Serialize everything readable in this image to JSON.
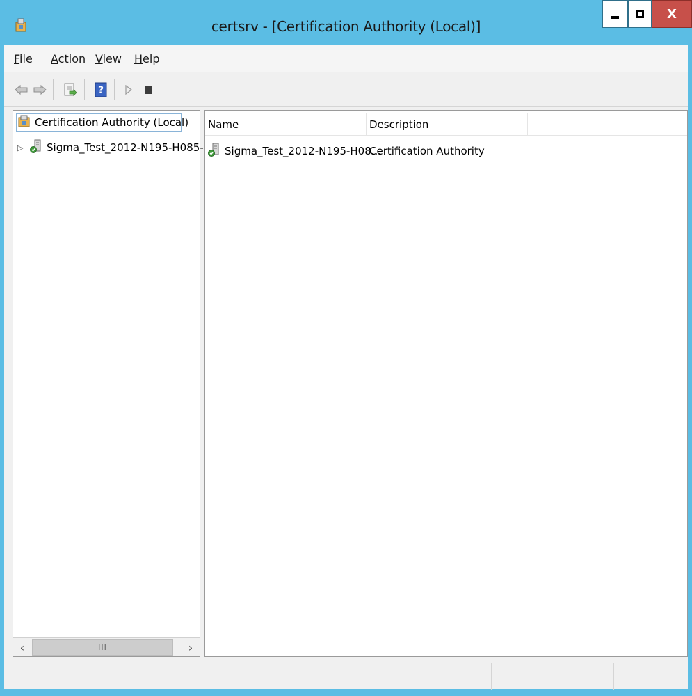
{
  "window": {
    "title": "certsrv - [Certification Authority (Local)]",
    "close_label": "X"
  },
  "menu": {
    "items": [
      {
        "label": "File"
      },
      {
        "label": "Action"
      },
      {
        "label": "View"
      },
      {
        "label": "Help"
      }
    ]
  },
  "toolbar": {
    "buttons": [
      "back-arrow-icon",
      "forward-arrow-icon",
      "export-list-icon",
      "help-icon",
      "start-service-icon",
      "stop-service-icon"
    ]
  },
  "tree": {
    "root_label": "Certification Authority (Local)",
    "child_label": "Sigma_Test_2012-N195-H085-",
    "scroll_thumb_grip": "III"
  },
  "list": {
    "columns": [
      "Name",
      "Description",
      ""
    ],
    "rows": [
      {
        "name": "Sigma_Test_2012-N195-H08...",
        "description": "Certification Authority"
      }
    ]
  },
  "colors": {
    "titlebar": "#5bbde4",
    "close_button": "#c7504a",
    "selection_border": "#8ab4d8"
  }
}
